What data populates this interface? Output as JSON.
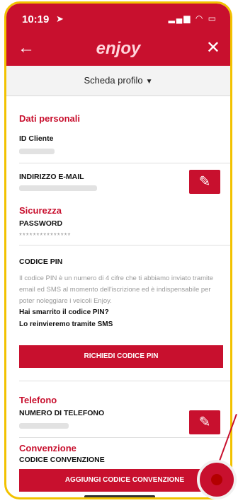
{
  "status": {
    "time": "10:19",
    "location_icon": "location-arrow-icon",
    "right_icons": "signal wifi battery"
  },
  "app": {
    "back": "←",
    "logo": "enjoy",
    "close": "✕"
  },
  "subheader": {
    "label": "Scheda profilo",
    "caret": "▼"
  },
  "sections": {
    "personal": "Dati personali",
    "id_label": "ID Cliente",
    "email_label": "INDIRIZZO E-MAIL",
    "security": "Sicurezza",
    "password_label": "PASSWORD",
    "password_value": "***************",
    "pin_label": "CODICE PIN",
    "pin_text": "Il codice PIN è un numero di 4 cifre che ti abbiamo inviato tramite email ed SMS al momento dell'iscrizione ed è indispensabile per poter noleggiare i veicoli Enjoy.",
    "pin_lost": "Hai smarrito il codice PIN?",
    "pin_resend": "Lo reinvieremo tramite SMS",
    "pin_button": "RICHIEDI CODICE PIN",
    "phone": "Telefono",
    "phone_label": "NUMERO DI TELEFONO",
    "convention": "Convenzione",
    "convention_label": "CODICE CONVENZIONE",
    "convention_button": "AGGIUNGI CODICE CONVENZIONE"
  },
  "icons": {
    "edit": "✎"
  },
  "colors": {
    "brand": "#c8102e",
    "frame": "#f2c200"
  }
}
